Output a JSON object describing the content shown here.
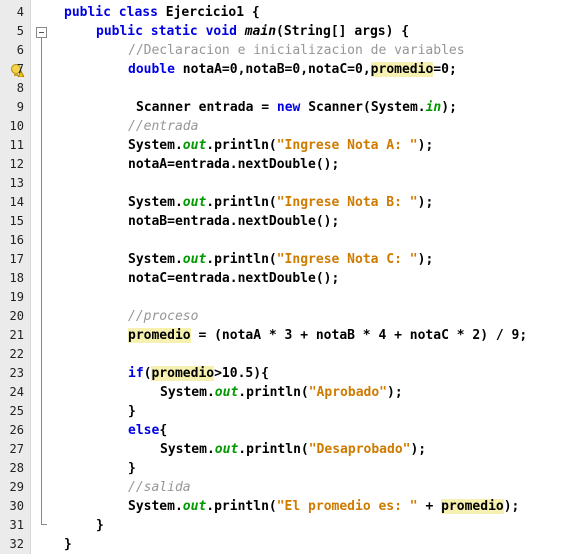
{
  "editor": {
    "lines": [
      {
        "n": "4"
      },
      {
        "n": "5"
      },
      {
        "n": "6"
      },
      {
        "n": "7"
      },
      {
        "n": "8"
      },
      {
        "n": "9"
      },
      {
        "n": "10"
      },
      {
        "n": "11"
      },
      {
        "n": "12"
      },
      {
        "n": "13"
      },
      {
        "n": "14"
      },
      {
        "n": "15"
      },
      {
        "n": "16"
      },
      {
        "n": "17"
      },
      {
        "n": "18"
      },
      {
        "n": "19"
      },
      {
        "n": "20"
      },
      {
        "n": "21"
      },
      {
        "n": "22"
      },
      {
        "n": "23"
      },
      {
        "n": "24"
      },
      {
        "n": "25"
      },
      {
        "n": "26"
      },
      {
        "n": "27"
      },
      {
        "n": "28"
      },
      {
        "n": "29"
      },
      {
        "n": "30"
      },
      {
        "n": "31"
      },
      {
        "n": "32"
      }
    ],
    "tokens": {
      "public": "public",
      "class": "class",
      "static": "static",
      "void": "void",
      "double": "double",
      "new": "new",
      "if": "if",
      "else": "else",
      "class_name": " Ejercicio1 {",
      "main": "main",
      "main_args": "(String[] args) {",
      "comment_decl": "//Declaracion e inicializacion de variables",
      "decl_vars": " notaA=",
      "zero": "0",
      "decl_b": ",notaB=",
      "decl_c": ",notaC=",
      "decl_sep": ",",
      "promedio": "promedio",
      "decl_end": "=",
      "semicolon": ";",
      "scanner_start": "Scanner entrada = ",
      "scanner_mid": " Scanner(System.",
      "in": "in",
      "scanner_end": ");",
      "comment_entrada": "//entrada",
      "sys": "System.",
      "out": "out",
      "println_open": ".println(",
      "str_a": "\"Ingrese Nota A: \"",
      "str_b": "\"Ingrese Nota B: \"",
      "str_c": "\"Ingrese Nota C: \"",
      "close": ");",
      "read_a": "notaA=entrada.nextDouble();",
      "read_b": "notaB=entrada.nextDouble();",
      "read_c": "notaC=entrada.nextDouble();",
      "comment_proceso": "//proceso",
      "calc": " = (notaA * 3 + notaB * 4 + notaC * 2) / 9;",
      "if_open": "(",
      "if_cond": ">10.5){",
      "str_aprobado": "\"Aprobado\"",
      "str_desaprobado": "\"Desaprobado\"",
      "brace_close": "}",
      "else_open": "{",
      "comment_salida": "//salida",
      "str_promedio": "\"El promedio es: \"",
      "plus": " + ",
      "brace_open": "{"
    }
  }
}
